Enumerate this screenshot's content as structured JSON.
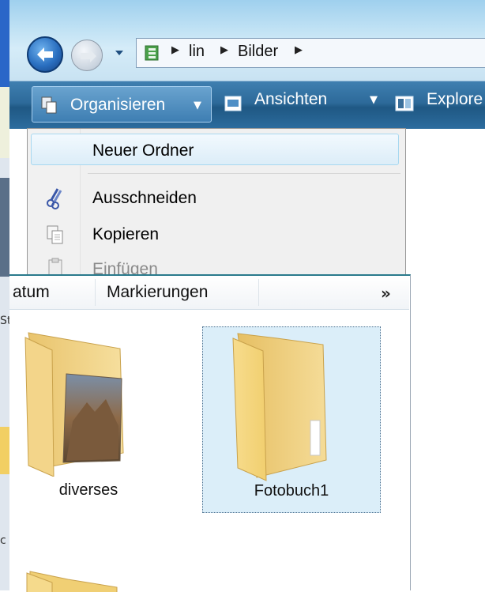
{
  "address_bar": {
    "crumbs": [
      "lin",
      "Bilder"
    ]
  },
  "command_bar": {
    "organize_label": "Organisieren",
    "views_label": "Ansichten",
    "explorer_label": "Explore"
  },
  "organize_menu": {
    "items": [
      {
        "label": "Neuer Ordner",
        "state": "highlighted"
      },
      {
        "label": "Ausschneiden",
        "state": "enabled"
      },
      {
        "label": "Kopieren",
        "state": "enabled"
      },
      {
        "label": "Einfügen",
        "state": "disabled"
      }
    ]
  },
  "columns": {
    "headers": [
      "atum",
      "Markierungen"
    ],
    "more": "»"
  },
  "files": [
    {
      "name": "diverses",
      "icon": "folder-with-photo-icon",
      "selected": false
    },
    {
      "name": "Fotobuch1",
      "icon": "folder-icon",
      "selected": true
    },
    {
      "name": "",
      "icon": "folder-icon",
      "selected": false
    }
  ],
  "left_strip_text": [
    "St",
    "c"
  ],
  "colors": {
    "command_bar": "#2d6a9a",
    "menu_highlight": "#dcedf8",
    "selection": "#dbeef9",
    "folder": "#f3d58a"
  }
}
